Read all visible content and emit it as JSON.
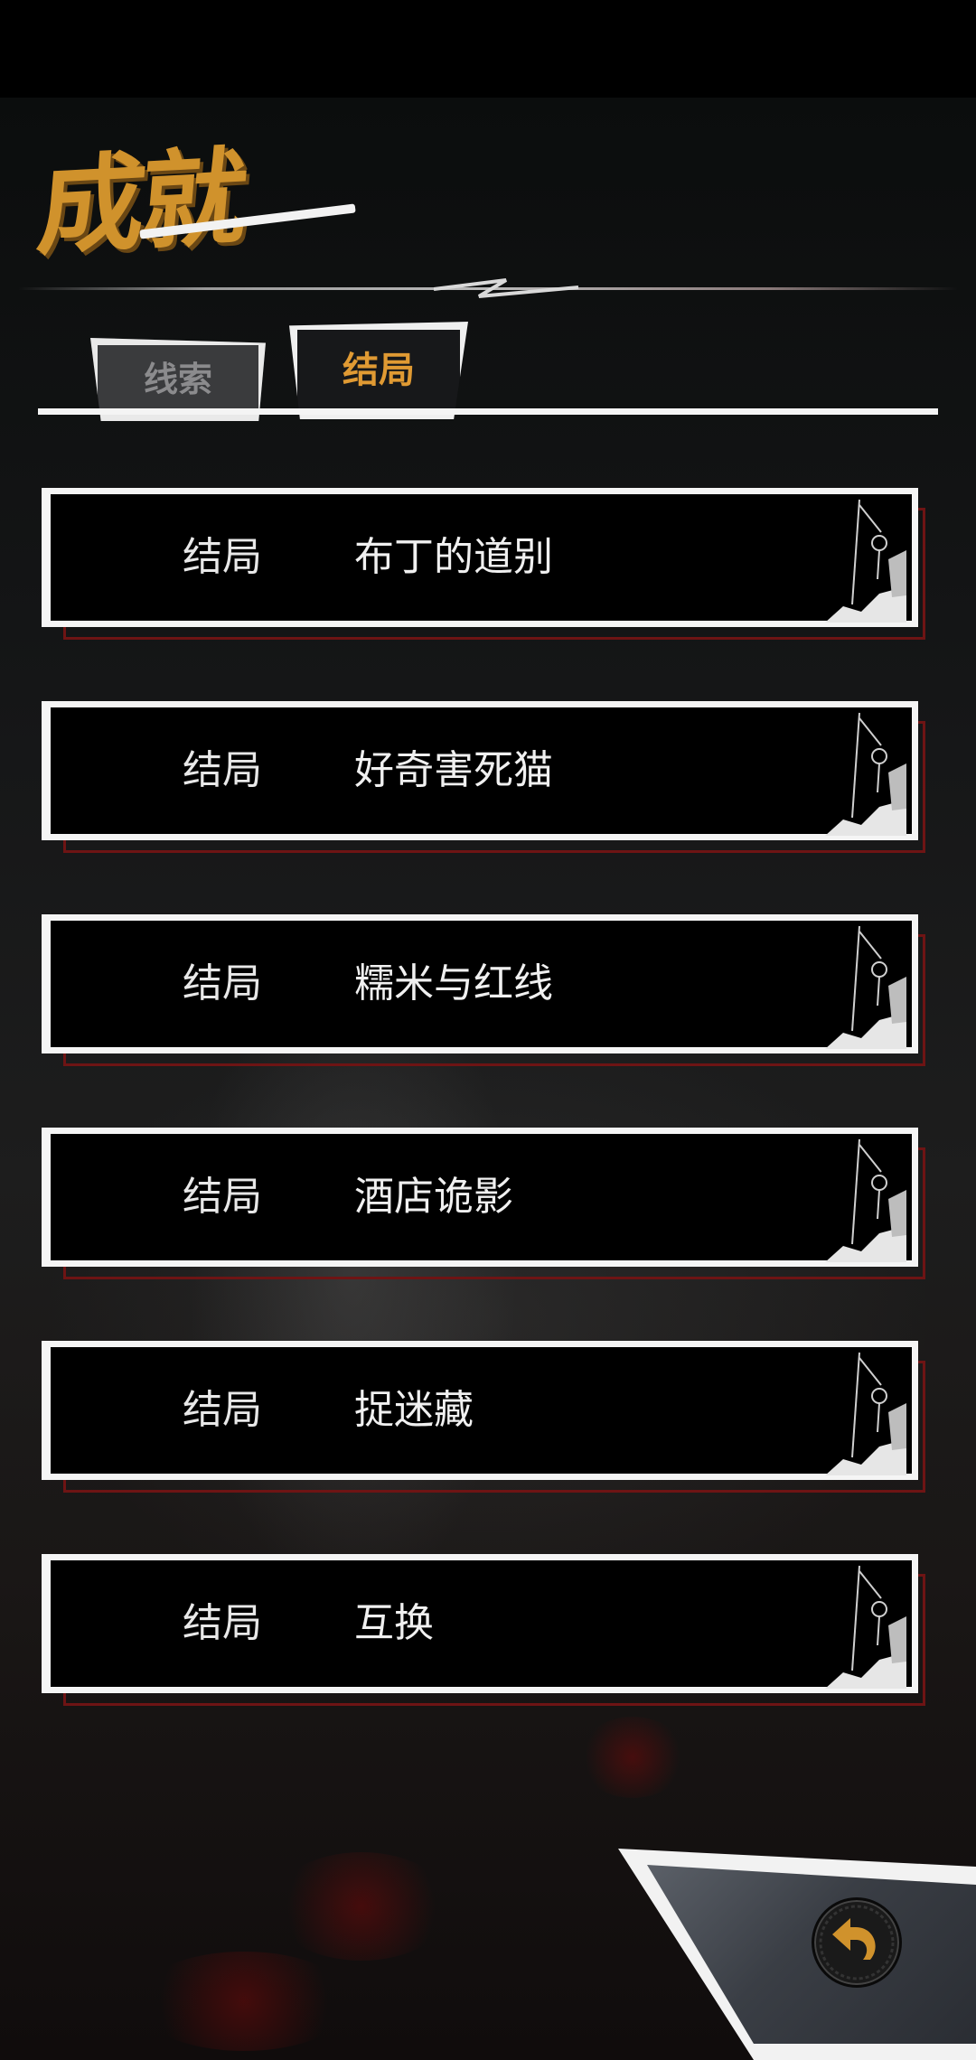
{
  "header": {
    "title": "成就"
  },
  "tabs": [
    {
      "label": "线索",
      "active": false
    },
    {
      "label": "结局",
      "active": true
    }
  ],
  "endings": [
    {
      "label": "结局",
      "name": "布丁的道别"
    },
    {
      "label": "结局",
      "name": "好奇害死猫"
    },
    {
      "label": "结局",
      "name": "糯米与红线"
    },
    {
      "label": "结局",
      "name": "酒店诡影"
    },
    {
      "label": "结局",
      "name": "捉迷藏"
    },
    {
      "label": "结局",
      "name": "互换"
    }
  ],
  "icons": {
    "back": "back-arrow-icon"
  },
  "colors": {
    "accent": "#d0922c",
    "tab_active_text": "#e09a33",
    "tab_inactive_text": "#8b8b8d",
    "card_border": "#f5f5f5",
    "card_shadow": "#6e1414"
  }
}
